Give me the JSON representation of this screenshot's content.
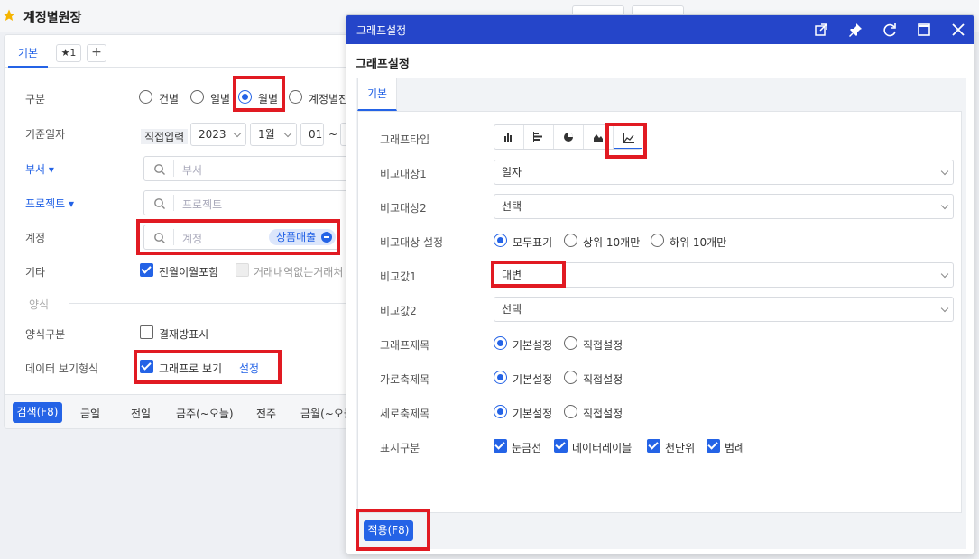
{
  "page": {
    "title": "계정별원장"
  },
  "tabs": {
    "basic": "기본",
    "star": "★1",
    "add": "+"
  },
  "form": {
    "category_label": "구분",
    "category_options": [
      "건별",
      "일별",
      "월별",
      "계정별잔"
    ],
    "category_selected": "월별",
    "date_label": "기준일자",
    "date_mode": "직접입력",
    "year": "2023",
    "month": "1월",
    "day": "01",
    "range_sep": "~",
    "dept_label": "부서",
    "dept_placeholder": "부서",
    "project_label": "프로젝트",
    "project_placeholder": "프로젝트",
    "account_label": "계정",
    "account_placeholder": "계정",
    "account_tag": "상품매출",
    "other_label": "기타",
    "other_opt1": "전월이월포함",
    "other_opt2": "거래내역없는거래처",
    "section_label": "양식",
    "form_type_label": "양식구분",
    "form_type_opt": "결재방표시",
    "view_label": "데이터 보기형식",
    "view_opt": "그래프로 보기",
    "view_settings": "설정"
  },
  "bottombar": {
    "search": "검색(F8)",
    "items": [
      "금일",
      "전일",
      "금주(~오늘)",
      "전주",
      "금월(~오늘)"
    ]
  },
  "modal": {
    "window_title": "그래프설정",
    "heading": "그래프설정",
    "tab": "기본",
    "graph_type_label": "그래프타입",
    "graph_types": [
      "bar-chart-icon",
      "horizontal-bar-icon",
      "pie-chart-icon",
      "area-chart-icon",
      "line-chart-icon"
    ],
    "graph_type_selected": "line-chart-icon",
    "compare1_label": "비교대상1",
    "compare1_value": "일자",
    "compare2_label": "비교대상2",
    "compare2_value": "선택",
    "compare_setting_label": "비교대상 설정",
    "compare_setting_options": [
      "모두표기",
      "상위 10개만",
      "하위 10개만"
    ],
    "value1_label": "비교값1",
    "value1_value": "대변",
    "value2_label": "비교값2",
    "value2_value": "선택",
    "graph_title_label": "그래프제목",
    "x_title_label": "가로축제목",
    "y_title_label": "세로축제목",
    "title_options": [
      "기본설정",
      "직접설정"
    ],
    "display_label": "표시구분",
    "display_options": [
      "눈금선",
      "데이터레이블",
      "천단위",
      "범례"
    ],
    "apply": "적용(F8)"
  },
  "colors": {
    "accent": "#2463e6",
    "header": "#2545c9",
    "highlight": "#e11a22"
  }
}
